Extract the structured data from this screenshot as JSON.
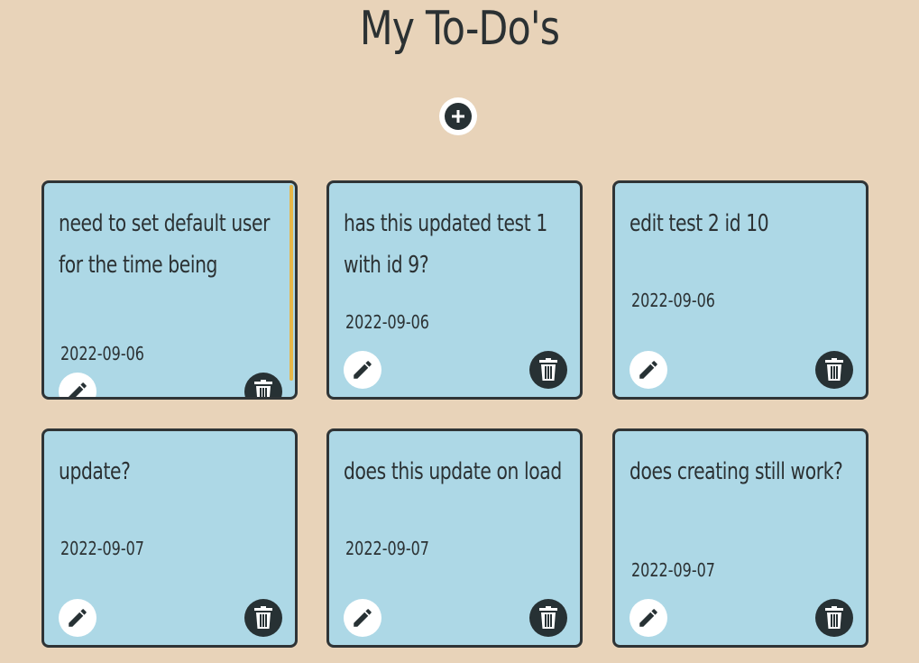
{
  "header": {
    "title": "My To-Do's"
  },
  "add_button": {
    "icon": "plus-circle-icon"
  },
  "todos": [
    {
      "text": "need to set default user for the time being",
      "date": "2022-09-06",
      "edit_icon": "pencil-icon",
      "delete_icon": "trash-icon"
    },
    {
      "text": "has this updated test 1 with id 9?",
      "date": "2022-09-06",
      "edit_icon": "pencil-icon",
      "delete_icon": "trash-icon"
    },
    {
      "text": "edit test 2 id 10",
      "date": "2022-09-06",
      "edit_icon": "pencil-icon",
      "delete_icon": "trash-icon"
    },
    {
      "text": "update?",
      "date": "2022-09-07",
      "edit_icon": "pencil-icon",
      "delete_icon": "trash-icon"
    },
    {
      "text": "does this update on load",
      "date": "2022-09-07",
      "edit_icon": "pencil-icon",
      "delete_icon": "trash-icon"
    },
    {
      "text": "does creating still work?",
      "date": "2022-09-07",
      "edit_icon": "pencil-icon",
      "delete_icon": "trash-icon"
    }
  ],
  "colors": {
    "background": "#e8d3b9",
    "card": "#add8e6",
    "card_border": "#2f3436",
    "icon_dark": "#273134",
    "scrollbar": "#e6b74a"
  }
}
